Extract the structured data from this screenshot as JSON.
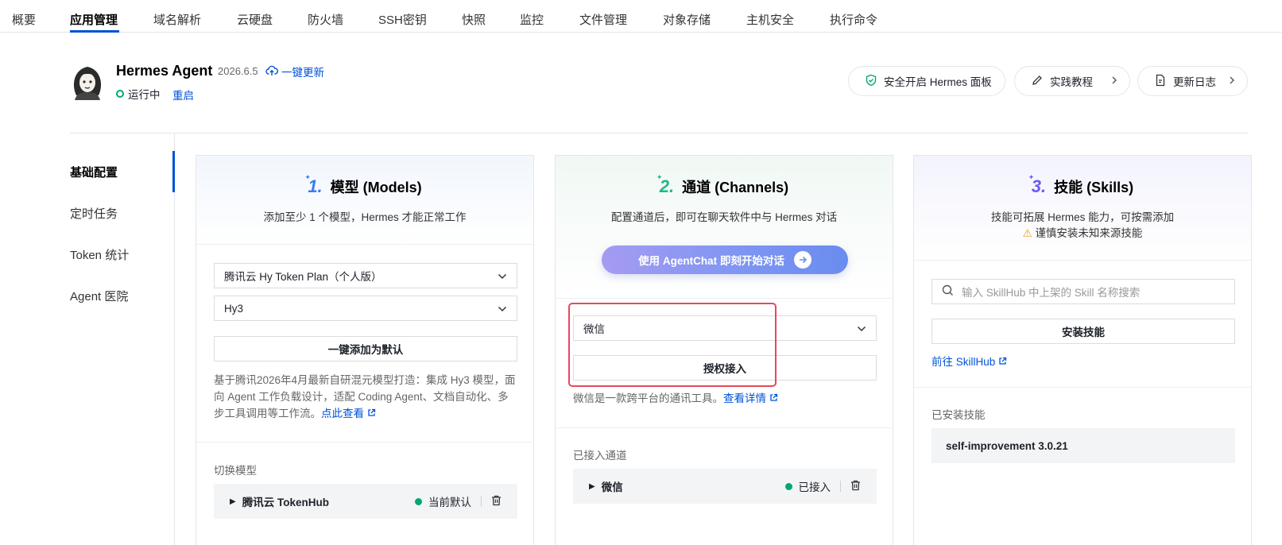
{
  "nav": {
    "tabs": [
      "概要",
      "应用管理",
      "域名解析",
      "云硬盘",
      "防火墙",
      "SSH密钥",
      "快照",
      "监控",
      "文件管理",
      "对象存储",
      "主机安全",
      "执行命令"
    ],
    "active": "应用管理"
  },
  "app": {
    "name": "Hermes Agent",
    "version": "2026.6.5",
    "update_label": "一键更新",
    "status": "运行中",
    "restart_label": "重启"
  },
  "header_buttons": {
    "panel": "安全开启 Hermes 面板",
    "tutorial": "实践教程",
    "changelog": "更新日志"
  },
  "sidebar": {
    "items": [
      "基础配置",
      "定时任务",
      "Token 统计",
      "Agent 医院"
    ],
    "active": "基础配置"
  },
  "models": {
    "num": "1.",
    "title": "模型 (Models)",
    "subtitle": "添加至少 1 个模型，Hermes 才能正常工作",
    "provider_select": "腾讯云 Hy Token Plan（个人版）",
    "model_select": "Hy3",
    "add_default_button": "一键添加为默认",
    "description": "基于腾讯2026年4月最新自研混元模型打造：集成 Hy3 模型，面向 Agent 工作负载设计，适配 Coding Agent、文档自动化、多步工具调用等工作流。",
    "view_link": "点此查看",
    "switch_label": "切换模型",
    "current_model": "腾讯云 TokenHub",
    "current_status": "当前默认",
    "accent": "#3b7cf0"
  },
  "channels": {
    "num": "2.",
    "title": "通道 (Channels)",
    "subtitle": "配置通道后，即可在聊天软件中与 Hermes 对话",
    "agentchat_button": "使用 AgentChat 即刻开始对话",
    "channel_select": "微信",
    "authorize_button": "授权接入",
    "description": "微信是一款跨平台的通讯工具。",
    "details_link": "查看详情",
    "connected_label": "已接入通道",
    "connected_item": "微信",
    "connected_status": "已接入",
    "accent": "#1fb88a"
  },
  "skills": {
    "num": "3.",
    "title": "技能 (Skills)",
    "subtitle": "技能可拓展 Hermes 能力，可按需添加",
    "warning": "谨慎安装未知来源技能",
    "search_placeholder": "输入 SkillHub 中上架的 Skill 名称搜索",
    "install_button": "安装技能",
    "skillhub_link": "前往 SkillHub",
    "installed_label": "已安装技能",
    "installed_item": "self-improvement 3.0.21",
    "accent": "#6a5cf0"
  }
}
